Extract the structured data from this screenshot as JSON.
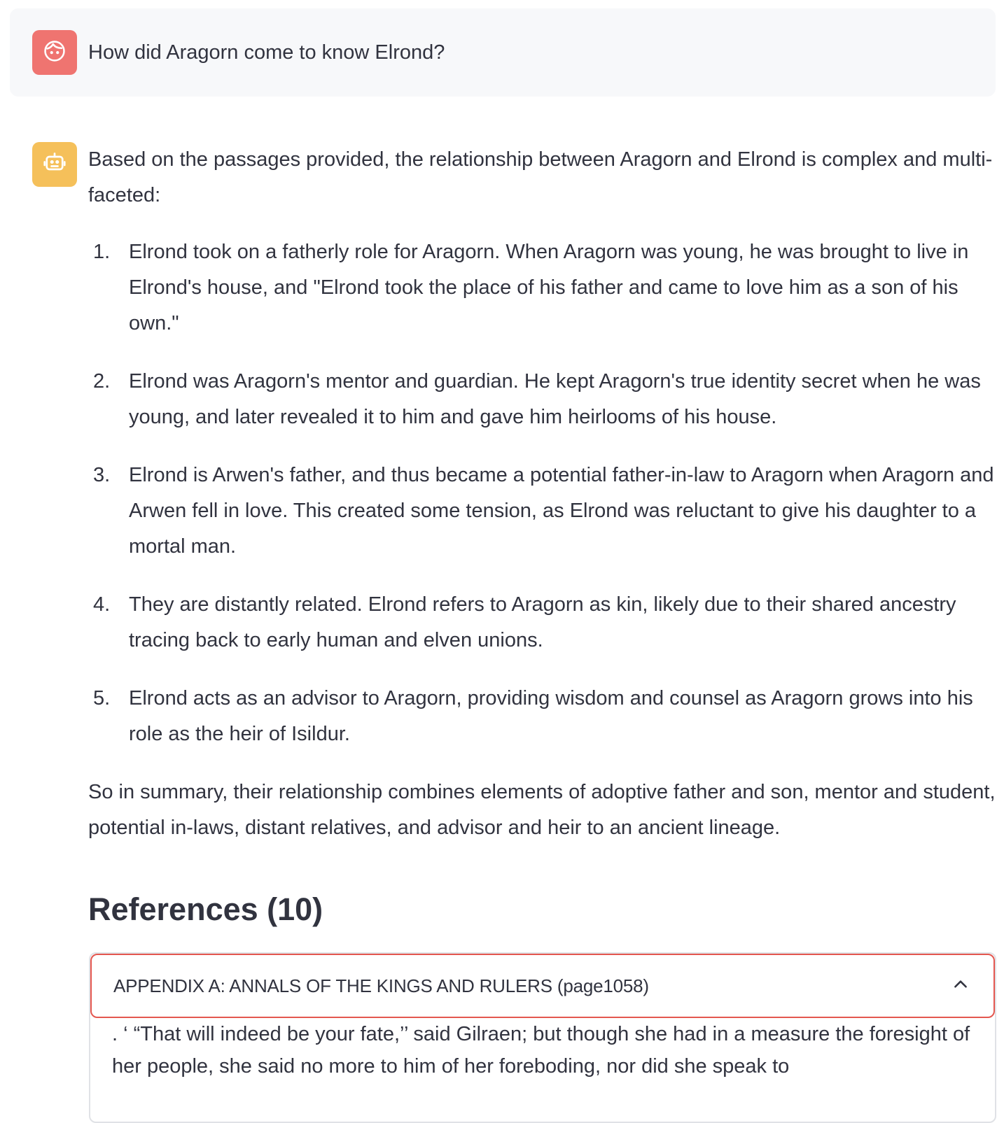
{
  "user_message": {
    "avatar_icon": "face-icon",
    "avatar_color": "#ef7470",
    "text": "How did Aragorn come to know Elrond?"
  },
  "assistant_message": {
    "avatar_icon": "robot-icon",
    "avatar_color": "#f5c05a",
    "intro": "Based on the passages provided, the relationship between Aragorn and Elrond is complex and multi-faceted:",
    "points": [
      {
        "num": "1.",
        "text": "Elrond took on a fatherly role for Aragorn. When Aragorn was young, he was brought to live in Elrond's house, and \"Elrond took the place of his father and came to love him as a son of his own.\""
      },
      {
        "num": "2.",
        "text": "Elrond was Aragorn's mentor and guardian. He kept Aragorn's true identity secret when he was young, and later revealed it to him and gave him heirlooms of his house."
      },
      {
        "num": "3.",
        "text": "Elrond is Arwen's father, and thus became a potential father-in-law to Aragorn when Aragorn and Arwen fell in love. This created some tension, as Elrond was reluctant to give his daughter to a mortal man."
      },
      {
        "num": "4.",
        "text": "They are distantly related. Elrond refers to Aragorn as kin, likely due to their shared ancestry tracing back to early human and elven unions."
      },
      {
        "num": "5.",
        "text": "Elrond acts as an advisor to Aragorn, providing wisdom and counsel as Aragorn grows into his role as the heir of Isildur."
      }
    ],
    "summary": "So in summary, their relationship combines elements of adoptive father and son, mentor and student, potential in-laws, distant relatives, and advisor and heir to an ancient lineage."
  },
  "references": {
    "heading": "References (10)",
    "items": [
      {
        "title": "APPENDIX A: ANNALS OF THE KINGS AND RULERS (page1058)",
        "toggle_icon": "chevron-up-icon",
        "body": ". ‘ “That will indeed be your fate,’’ said Gilraen; but though she had in a measure the foresight of her people, she said no more to him of her foreboding, nor did she speak to"
      }
    ]
  },
  "colors": {
    "text": "#31333f",
    "user_bubble_bg": "#f7f8fa",
    "expander_active_border": "#e4574f",
    "expander_border": "#e0e2e6"
  }
}
